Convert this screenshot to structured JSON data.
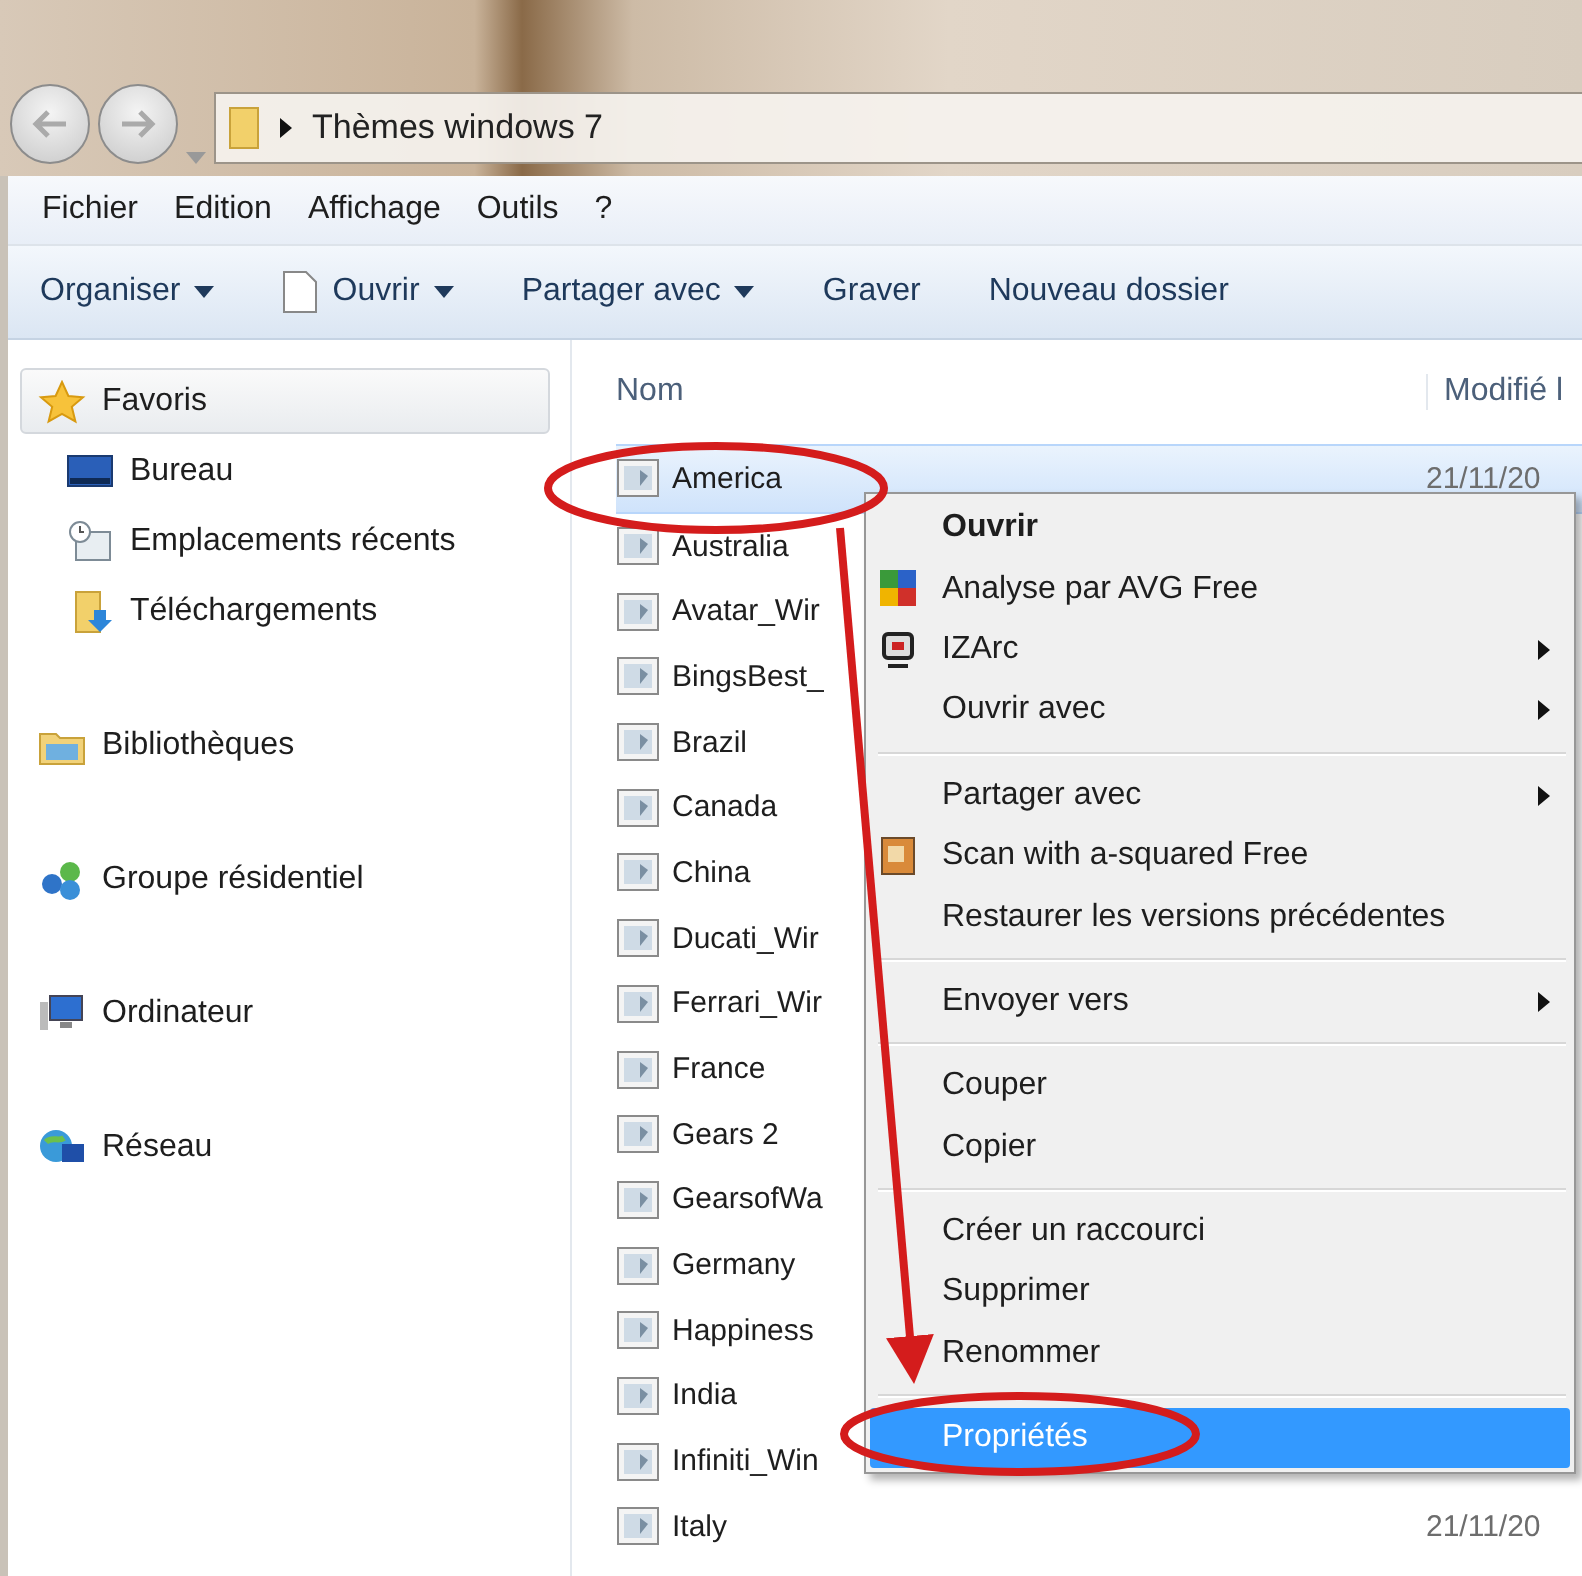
{
  "address_bar": {
    "path": "Thèmes windows 7"
  },
  "menu_bar": [
    "Fichier",
    "Edition",
    "Affichage",
    "Outils",
    "?"
  ],
  "toolbar": [
    {
      "label": "Organiser",
      "dropdown": true
    },
    {
      "label": "Ouvrir",
      "dropdown": true
    },
    {
      "label": "Partager avec",
      "dropdown": true
    },
    {
      "label": "Graver",
      "dropdown": false
    },
    {
      "label": "Nouveau dossier",
      "dropdown": false
    }
  ],
  "sidebar": [
    {
      "label": "Favoris",
      "selected": true,
      "children": [
        {
          "label": "Bureau"
        },
        {
          "label": "Emplacements récents"
        },
        {
          "label": "Téléchargements"
        }
      ]
    },
    {
      "label": "Bibliothèques",
      "selected": false
    },
    {
      "label": "Groupe résidentiel",
      "selected": false
    },
    {
      "label": "Ordinateur",
      "selected": false
    },
    {
      "label": "Réseau",
      "selected": false
    }
  ],
  "file_list": {
    "columns": [
      "Nom",
      "Modifié l"
    ],
    "rows": [
      {
        "name": "America",
        "date": "21/11/20",
        "selected": true
      },
      {
        "name": "Australia",
        "selected": false
      },
      {
        "name": "Avatar_Wir",
        "selected": false
      },
      {
        "name": "BingsBest_",
        "selected": false
      },
      {
        "name": "Brazil",
        "selected": false
      },
      {
        "name": "Canada",
        "selected": false
      },
      {
        "name": "China",
        "selected": false
      },
      {
        "name": "Ducati_Wir",
        "selected": false
      },
      {
        "name": "Ferrari_Wir",
        "selected": false
      },
      {
        "name": "France",
        "selected": false
      },
      {
        "name": "Gears 2",
        "selected": false
      },
      {
        "name": "GearsofWa",
        "selected": false
      },
      {
        "name": "Germany",
        "selected": false
      },
      {
        "name": "Happiness",
        "selected": false
      },
      {
        "name": "India",
        "selected": false
      },
      {
        "name": "Infiniti_Win",
        "selected": false
      },
      {
        "name": "Italy",
        "date": "21/11/20",
        "selected": false
      }
    ]
  },
  "context_menu": [
    {
      "kind": "item",
      "label": "Ouvrir",
      "bold": true,
      "submenu": false,
      "selected": false
    },
    {
      "kind": "item",
      "label": "Analyse par AVG Free",
      "bold": false,
      "submenu": false,
      "selected": false
    },
    {
      "kind": "item",
      "label": "IZArc",
      "bold": false,
      "submenu": true,
      "selected": false
    },
    {
      "kind": "item",
      "label": "Ouvrir avec",
      "bold": false,
      "submenu": true,
      "selected": false
    },
    {
      "kind": "separator"
    },
    {
      "kind": "item",
      "label": "Partager avec",
      "bold": false,
      "submenu": true,
      "selected": false
    },
    {
      "kind": "item",
      "label": "Scan with a-squared Free",
      "bold": false,
      "submenu": false,
      "selected": false
    },
    {
      "kind": "item",
      "label": "Restaurer les versions précédentes",
      "bold": false,
      "submenu": false,
      "selected": false
    },
    {
      "kind": "separator"
    },
    {
      "kind": "item",
      "label": "Envoyer vers",
      "bold": false,
      "submenu": true,
      "selected": false
    },
    {
      "kind": "separator"
    },
    {
      "kind": "item",
      "label": "Couper",
      "bold": false,
      "submenu": false,
      "selected": false
    },
    {
      "kind": "item",
      "label": "Copier",
      "bold": false,
      "submenu": false,
      "selected": false
    },
    {
      "kind": "separator"
    },
    {
      "kind": "item",
      "label": "Créer un raccourci",
      "bold": false,
      "submenu": false,
      "selected": false
    },
    {
      "kind": "item",
      "label": "Supprimer",
      "bold": false,
      "submenu": false,
      "selected": false
    },
    {
      "kind": "item",
      "label": "Renommer",
      "bold": false,
      "submenu": false,
      "selected": false
    },
    {
      "kind": "separator"
    },
    {
      "kind": "item",
      "label": "Propriétés",
      "bold": false,
      "submenu": false,
      "selected": true
    }
  ]
}
